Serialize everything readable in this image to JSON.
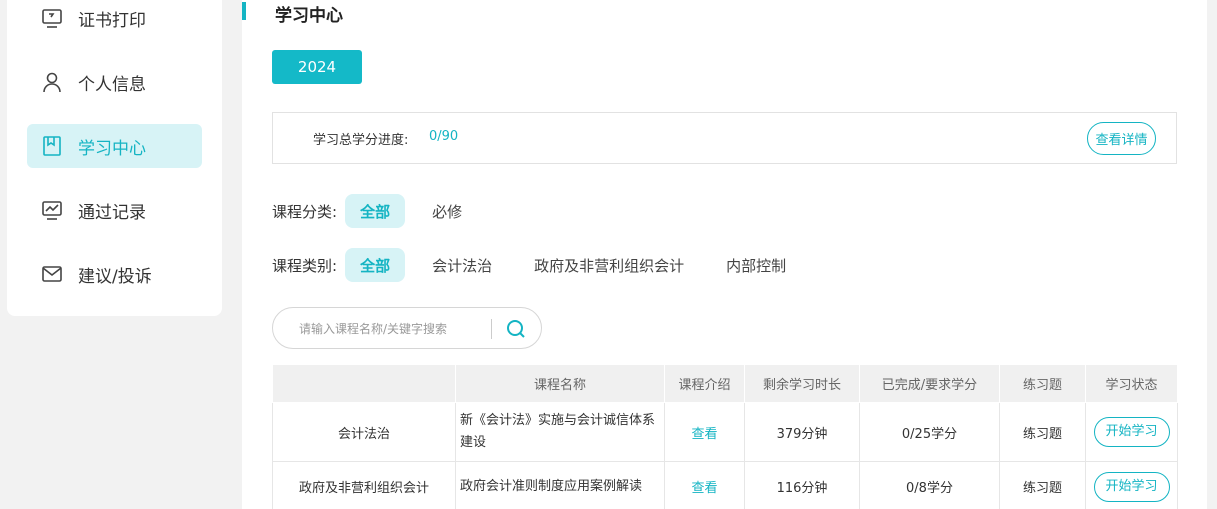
{
  "sidebar": {
    "items": [
      {
        "label": "证书打印",
        "icon": "certificate-print-icon"
      },
      {
        "label": "个人信息",
        "icon": "user-icon"
      },
      {
        "label": "学习中心",
        "icon": "bookmark-icon"
      },
      {
        "label": "通过记录",
        "icon": "chart-monitor-icon"
      },
      {
        "label": "建议/投诉",
        "icon": "envelope-icon"
      }
    ],
    "active_label": "学习中心"
  },
  "main": {
    "title": "学习中心",
    "year": "2024",
    "progress": {
      "label": "学习总学分进度:",
      "value": "0/90",
      "detail_button": "查看详情"
    },
    "filters": {
      "category": {
        "label": "课程分类:",
        "options": [
          "全部",
          "必修"
        ],
        "selected": "全部"
      },
      "type": {
        "label": "课程类别:",
        "options": [
          "全部",
          "会计法治",
          "政府及非营利组织会计",
          "内部控制"
        ],
        "selected": "全部"
      }
    },
    "search": {
      "placeholder": "请输入课程名称/关键字搜索",
      "value": ""
    },
    "table": {
      "headers": [
        "",
        "课程名称",
        "课程介绍",
        "剩余学习时长",
        "已完成/要求学分",
        "练习题",
        "学习状态"
      ],
      "rows": [
        {
          "category": "会计法治",
          "name": "新《会计法》实施与会计诚信体系建设",
          "intro": "查看",
          "remaining": "379分钟",
          "credits": "0/25学分",
          "exercise": "练习题",
          "status": "开始学习"
        },
        {
          "category": "政府及非营利组织会计",
          "name": "政府会计准则制度应用案例解读",
          "intro": "查看",
          "remaining": "116分钟",
          "credits": "0/8学分",
          "exercise": "练习题",
          "status": "开始学习"
        }
      ]
    }
  },
  "colors": {
    "accent": "#14b4c3",
    "accent_bg": "#d7f3f6",
    "year_button": "#14b9c8",
    "page_bg": "#f2f2f2"
  }
}
